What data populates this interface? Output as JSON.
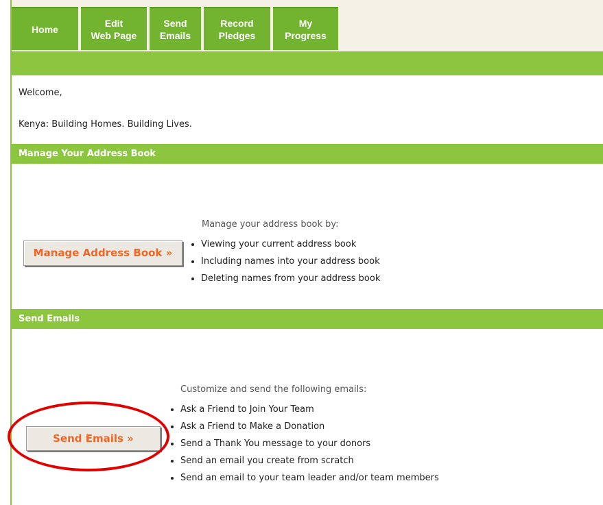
{
  "nav": {
    "tabs": [
      {
        "line1": "Home",
        "line2": ""
      },
      {
        "line1": "Edit",
        "line2": "Web Page"
      },
      {
        "line1": "Send",
        "line2": "Emails"
      },
      {
        "line1": "Record",
        "line2": "Pledges"
      },
      {
        "line1": "My",
        "line2": "Progress"
      }
    ]
  },
  "welcome": {
    "greeting": "Welcome,",
    "campaign": "Kenya: Building Homes. Building Lives."
  },
  "address_book": {
    "header": "Manage Your Address Book",
    "button_label": "Manage Address Book »",
    "description": "Manage your address book by:",
    "items": [
      "Viewing your current address book",
      "Including names into your address book",
      "Deleting names from your address book"
    ]
  },
  "send_emails": {
    "header": "Send Emails",
    "button_label": "Send Emails »",
    "description": "Customize and send the following emails:",
    "items": [
      "Ask a Friend to Join Your Team",
      "Ask a Friend to Make a Donation",
      "Send a Thank You message to your donors",
      "Send an email you create from scratch",
      "Send an email to your team leader and/or team members"
    ]
  },
  "colors": {
    "tab_green": "#72b32f",
    "header_green": "#8cc63f",
    "button_text": "#f26522",
    "annotation_red": "#e00000"
  }
}
